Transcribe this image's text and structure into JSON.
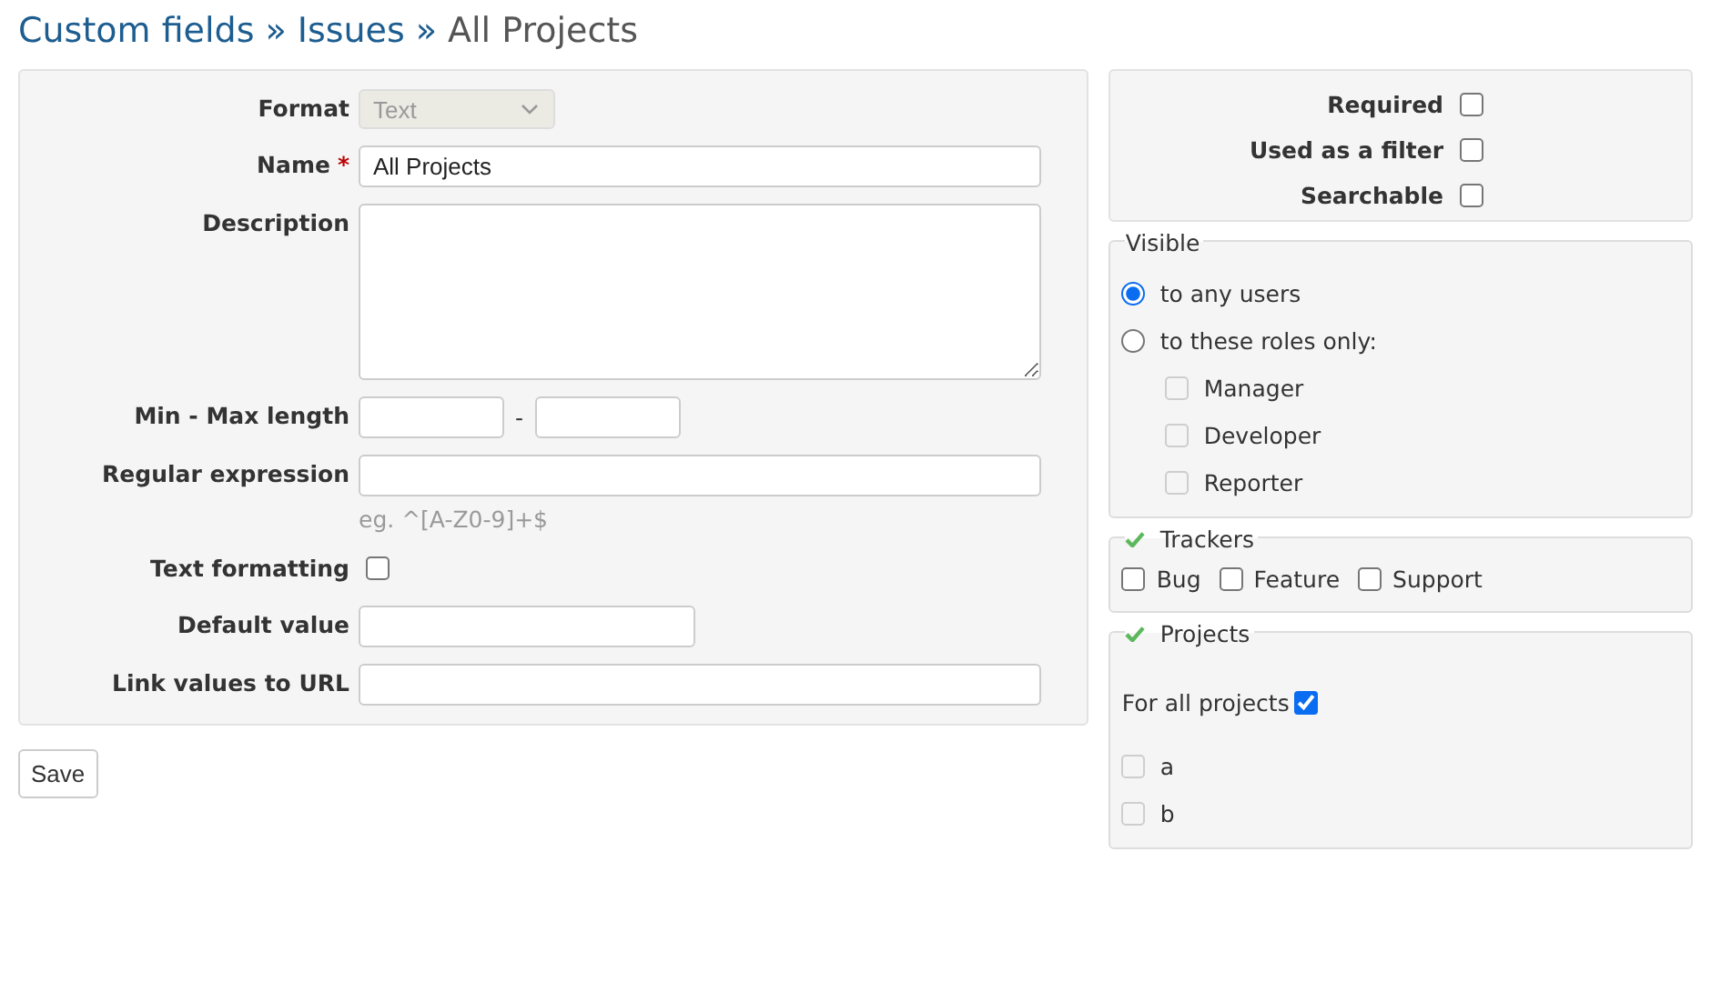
{
  "breadcrumb": [
    {
      "label": "Custom fields",
      "kind": "link"
    },
    {
      "label": "»",
      "kind": "separator"
    },
    {
      "label": "Issues",
      "kind": "link"
    },
    {
      "label": "»",
      "kind": "separator"
    },
    {
      "label": "All Projects",
      "kind": "current"
    }
  ],
  "fields": [
    {
      "kind": "select",
      "label": "Format",
      "value": "Text",
      "disabled": true
    },
    {
      "kind": "text",
      "label": "Name",
      "required_mark": "*",
      "value": "All Projects"
    },
    {
      "kind": "textarea",
      "label": "Description"
    },
    {
      "kind": "range",
      "label": "Min - Max length",
      "separator": "-"
    },
    {
      "kind": "text",
      "label": "Regular expression",
      "hint": "eg. ^[A-Z0-9]+$"
    },
    {
      "kind": "checkbox",
      "label": "Text formatting",
      "checked": false
    },
    {
      "kind": "short_text",
      "label": "Default value"
    },
    {
      "kind": "text",
      "label": "Link values to URL"
    }
  ],
  "save_button": "Save",
  "flags": [
    {
      "label": "Required",
      "checked": false
    },
    {
      "label": "Used as a filter",
      "checked": false
    },
    {
      "label": "Searchable",
      "checked": false
    }
  ],
  "visible": {
    "legend": "Visible",
    "options": [
      {
        "label": "to any users",
        "selected": true
      },
      {
        "label": "to these roles only:",
        "selected": false
      }
    ],
    "roles": [
      {
        "label": "Manager",
        "checked": false,
        "disabled": true
      },
      {
        "label": "Developer",
        "checked": false,
        "disabled": true
      },
      {
        "label": "Reporter",
        "checked": false,
        "disabled": true
      }
    ]
  },
  "trackers": {
    "legend": "Trackers",
    "items": [
      {
        "label": "Bug",
        "checked": false
      },
      {
        "label": "Feature",
        "checked": false
      },
      {
        "label": "Support",
        "checked": false
      }
    ]
  },
  "projects": {
    "legend": "Projects",
    "all_label": "For all projects",
    "all_checked": true,
    "items": [
      {
        "label": "a",
        "checked": false,
        "disabled": true
      },
      {
        "label": "b",
        "checked": false,
        "disabled": true
      }
    ]
  }
}
